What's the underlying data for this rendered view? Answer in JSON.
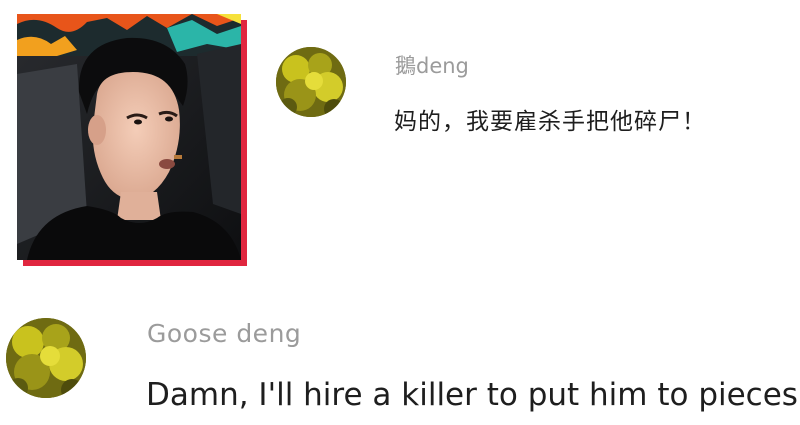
{
  "thumbnail": {
    "icon": "video-frame-person",
    "shadow_color": "#e0263f"
  },
  "comments": [
    {
      "avatar_icon": "moss-avatar-icon",
      "username": "鵝deng",
      "text": "妈的，我要雇杀手把他碎尸！"
    },
    {
      "avatar_icon": "moss-avatar-icon",
      "username": "Goose deng",
      "text": "Damn, I'll hire a killer to put him to pieces!"
    }
  ],
  "colors": {
    "username": "#9b9b9b",
    "comment_text": "#1e1e1e",
    "background": "#ffffff"
  }
}
